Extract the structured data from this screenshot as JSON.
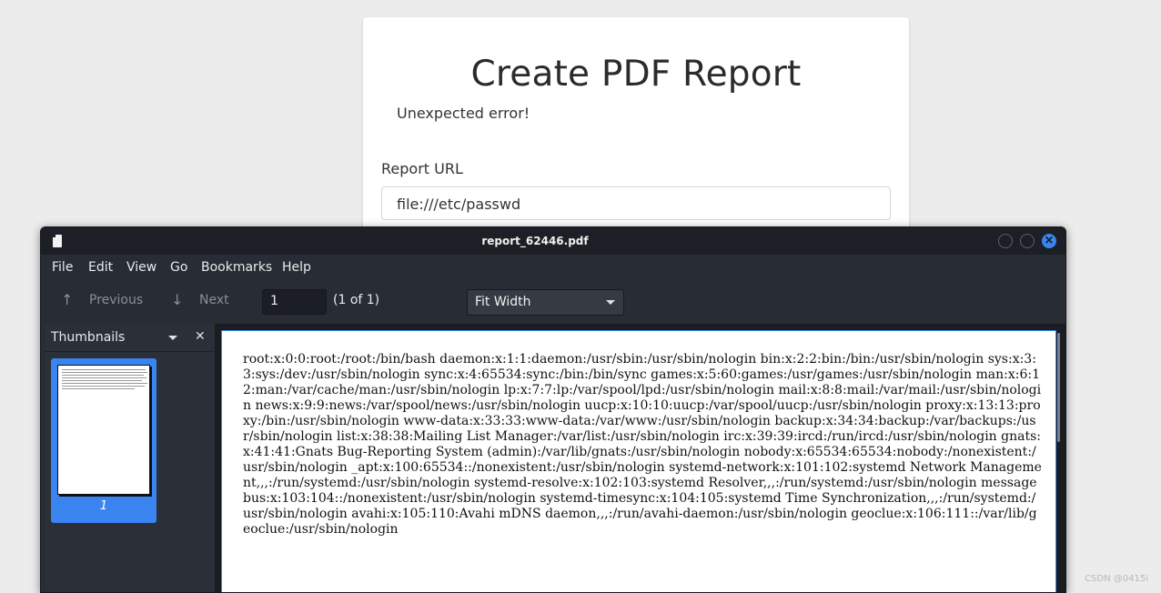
{
  "web_page": {
    "title": "Create PDF Report",
    "alert": "Unexpected error!",
    "url_label": "Report URL",
    "url_value": "file:///etc/passwd"
  },
  "viewer": {
    "window_title": "report_62446.pdf",
    "menu": [
      "File",
      "Edit",
      "View",
      "Go",
      "Bookmarks",
      "Help"
    ],
    "toolbar": {
      "previous_label": "Previous",
      "next_label": "Next",
      "page_value": "1",
      "page_count": "(1 of 1)",
      "zoom_value": "Fit Width"
    },
    "sidebar": {
      "title": "Thumbnails",
      "thumb_page_label": "1"
    },
    "document_text": "root:x:0:0:root:/root:/bin/bash daemon:x:1:1:daemon:/usr/sbin:/usr/sbin/nologin bin:x:2:2:bin:/bin:/usr/sbin/nologin sys:x:3:3:sys:/dev:/usr/sbin/nologin sync:x:4:65534:sync:/bin:/bin/sync games:x:5:60:games:/usr/games:/usr/sbin/nologin man:x:6:12:man:/var/cache/man:/usr/sbin/nologin lp:x:7:7:lp:/var/spool/lpd:/usr/sbin/nologin mail:x:8:8:mail:/var/mail:/usr/sbin/nologin news:x:9:9:news:/var/spool/news:/usr/sbin/nologin uucp:x:10:10:uucp:/var/spool/uucp:/usr/sbin/nologin proxy:x:13:13:proxy:/bin:/usr/sbin/nologin www-data:x:33:33:www-data:/var/www:/usr/sbin/nologin backup:x:34:34:backup:/var/backups:/usr/sbin/nologin list:x:38:38:Mailing List Manager:/var/list:/usr/sbin/nologin irc:x:39:39:ircd:/run/ircd:/usr/sbin/nologin gnats:x:41:41:Gnats Bug-Reporting System (admin):/var/lib/gnats:/usr/sbin/nologin nobody:x:65534:65534:nobody:/nonexistent:/usr/sbin/nologin _apt:x:100:65534::/nonexistent:/usr/sbin/nologin systemd-network:x:101:102:systemd Network Management,,,:/run/systemd:/usr/sbin/nologin systemd-resolve:x:102:103:systemd Resolver,,,:/run/systemd:/usr/sbin/nologin messagebus:x:103:104::/nonexistent:/usr/sbin/nologin systemd-timesync:x:104:105:systemd Time Synchronization,,,:/run/systemd:/usr/sbin/nologin avahi:x:105:110:Avahi mDNS daemon,,,:/run/avahi-daemon:/usr/sbin/nologin geoclue:x:106:111::/var/lib/geoclue:/usr/sbin/nologin"
  },
  "watermark": "CSDN @0415i",
  "colors": {
    "accent": "#3a84f0",
    "window_bg": "#282c34",
    "titlebar_bg": "#1c1f25"
  },
  "icons": {
    "app": "document-icon",
    "previous": "arrow-up-icon",
    "next": "arrow-down-icon",
    "zoom_dropdown": "chevron-down-icon",
    "sidebar_dropdown": "chevron-down-icon",
    "sidebar_close": "close-icon",
    "window_close": "close-icon"
  }
}
